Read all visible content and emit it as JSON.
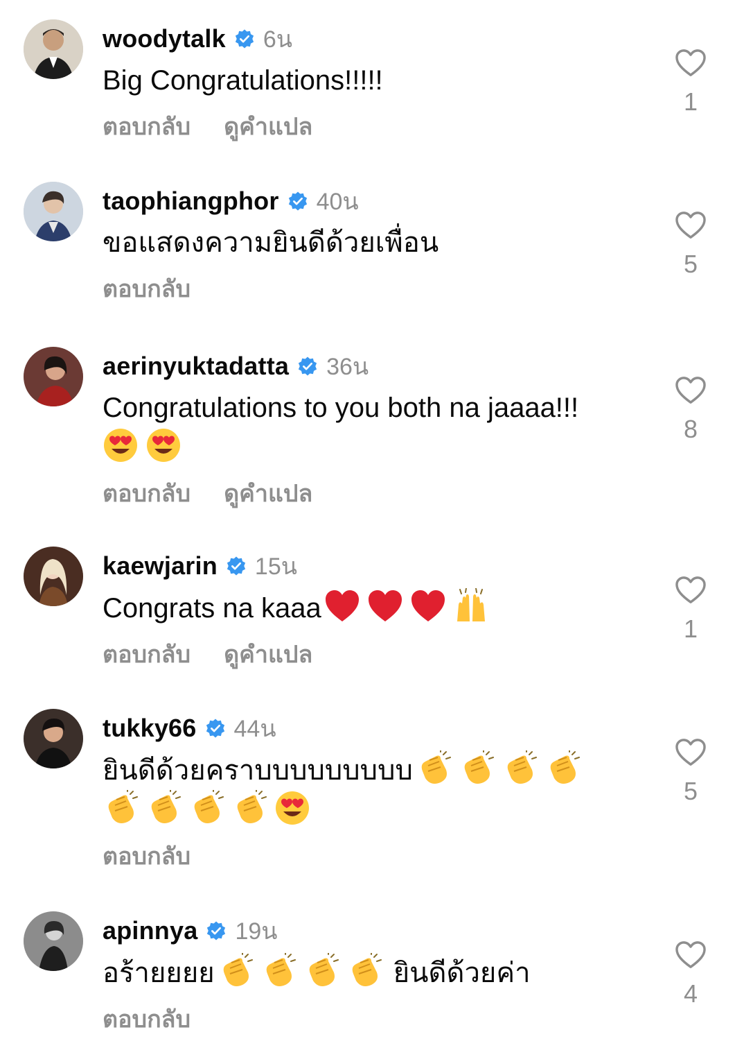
{
  "comments": [
    {
      "username": "woodytalk",
      "time": "6น",
      "text": "Big Congratulations!!!!!",
      "emojis_line2": [],
      "emojis_inline": [],
      "reply": "ตอบกลับ",
      "translate": "ดูคำแปล",
      "likes": "1"
    },
    {
      "username": "taophiangphor",
      "time": "40น",
      "text": "ขอแสดงความยินดีด้วยเพื่อน",
      "emojis_line2": [],
      "emojis_inline": [],
      "reply": "ตอบกลับ",
      "translate": "",
      "likes": "5"
    },
    {
      "username": "aerinyuktadatta",
      "time": "36น",
      "text": "Congratulations to you both na jaaaa!!!",
      "emojis_line2": [
        "heart-eyes",
        "heart-eyes"
      ],
      "emojis_inline": [],
      "reply": "ตอบกลับ",
      "translate": "ดูคำแปล",
      "likes": "8"
    },
    {
      "username": "kaewjarin",
      "time": "15น",
      "text": "Congrats na kaaa",
      "emojis_inline": [
        "red-heart",
        "red-heart",
        "red-heart",
        "raised-hands"
      ],
      "emojis_line2": [],
      "reply": "ตอบกลับ",
      "translate": "ดูคำแปล",
      "likes": "1"
    },
    {
      "username": "tukky66",
      "time": "44น",
      "text": "ยินดีด้วยคราบบบบบบบบบ",
      "emojis_inline": [
        "clapping-hands",
        "clapping-hands",
        "clapping-hands",
        "clapping-hands"
      ],
      "emojis_line2": [
        "clapping-hands",
        "clapping-hands",
        "clapping-hands",
        "clapping-hands",
        "heart-eyes"
      ],
      "reply": "ตอบกลับ",
      "translate": "",
      "likes": "5"
    },
    {
      "username": "apinnya",
      "time": "19น",
      "text": "อร้ายยยย",
      "emojis_inline": [
        "clapping-hands",
        "clapping-hands",
        "clapping-hands",
        "clapping-hands"
      ],
      "text_after": "ยินดีด้วยค่า",
      "emojis_line2": [],
      "reply": "ตอบกลับ",
      "translate": "",
      "likes": "4"
    }
  ],
  "colors": {
    "verified": "#3897f0",
    "meta": "#8e8e8e",
    "heart_outline": "#8e8e8e"
  }
}
